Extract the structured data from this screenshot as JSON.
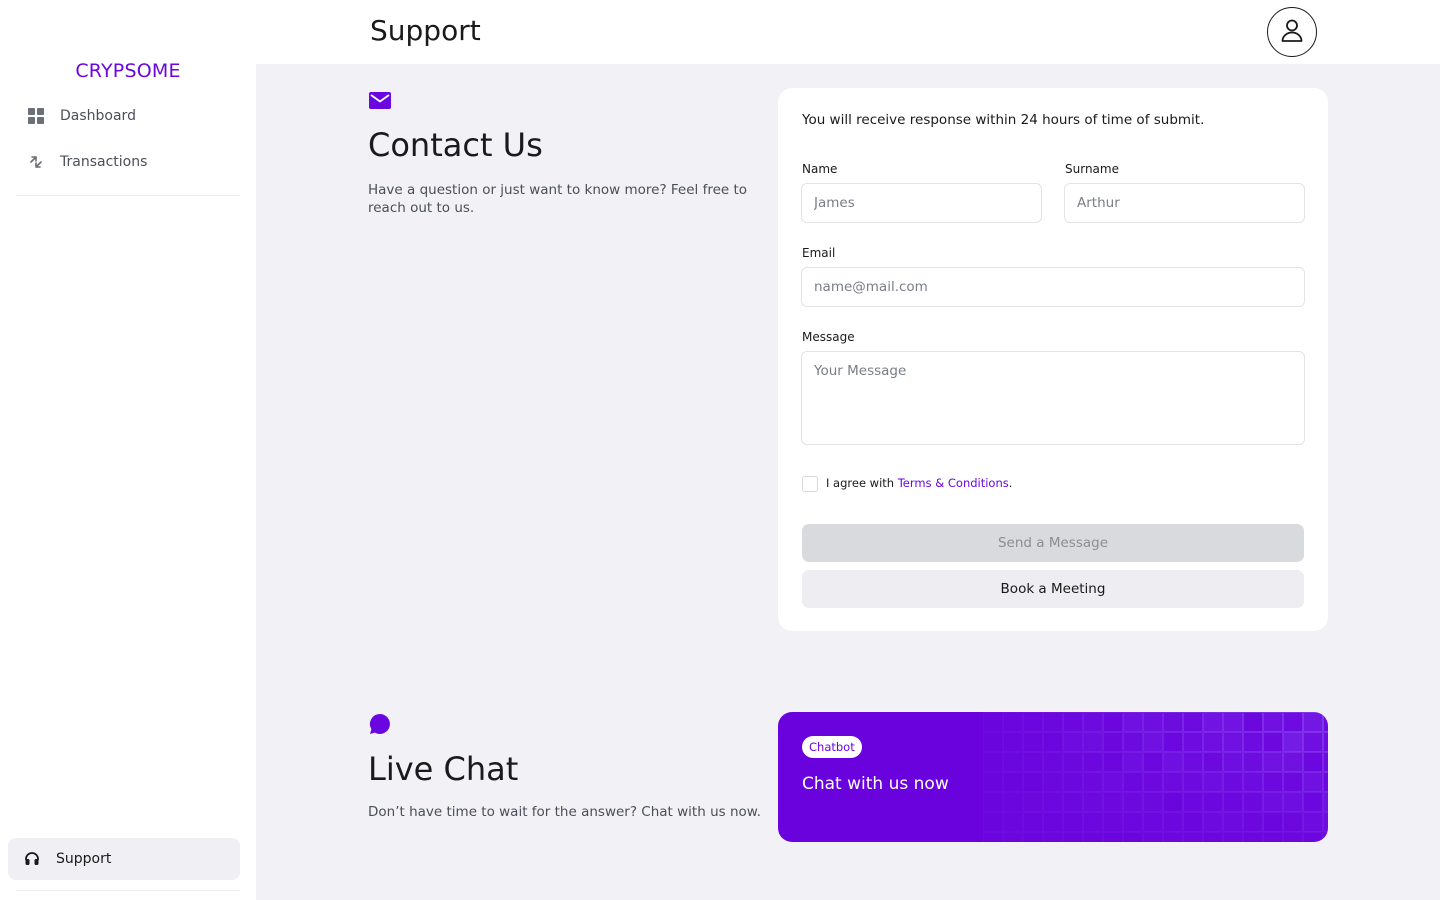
{
  "sidebar": {
    "logo": "CRYPSOME",
    "items": [
      {
        "label": "Dashboard",
        "icon": "grid-icon"
      },
      {
        "label": "Transactions",
        "icon": "arrows-exchange-icon"
      }
    ],
    "support": {
      "label": "Support",
      "icon": "headset-icon"
    }
  },
  "header": {
    "title": "Support",
    "avatar_icon": "user-icon"
  },
  "contact": {
    "icon": "mail-icon",
    "heading": "Contact Us",
    "description": "Have a question or just want to know more? Feel free to reach out to us."
  },
  "form": {
    "note": "You will receive response within 24 hours of time of submit.",
    "name_label": "Name",
    "name_placeholder": "James",
    "surname_label": "Surname",
    "surname_placeholder": "Arthur",
    "email_label": "Email",
    "email_placeholder": "name@mail.com",
    "message_label": "Message",
    "message_placeholder": "Your Message",
    "agree_prefix": "I agree with ",
    "terms_link": "Terms & Conditions",
    "agree_suffix": ".",
    "send_label": "Send a Message",
    "book_label": "Book a Meeting"
  },
  "live_chat": {
    "icon": "chat-bubble-icon",
    "heading": "Live Chat",
    "description": "Don’t have time to wait for the answer? Chat with us now.",
    "badge": "Chatbot",
    "cta": "Chat with us now"
  },
  "colors": {
    "accent": "#6a06e0",
    "chat_card": "#6a02dd",
    "background": "#f2f1f6"
  }
}
